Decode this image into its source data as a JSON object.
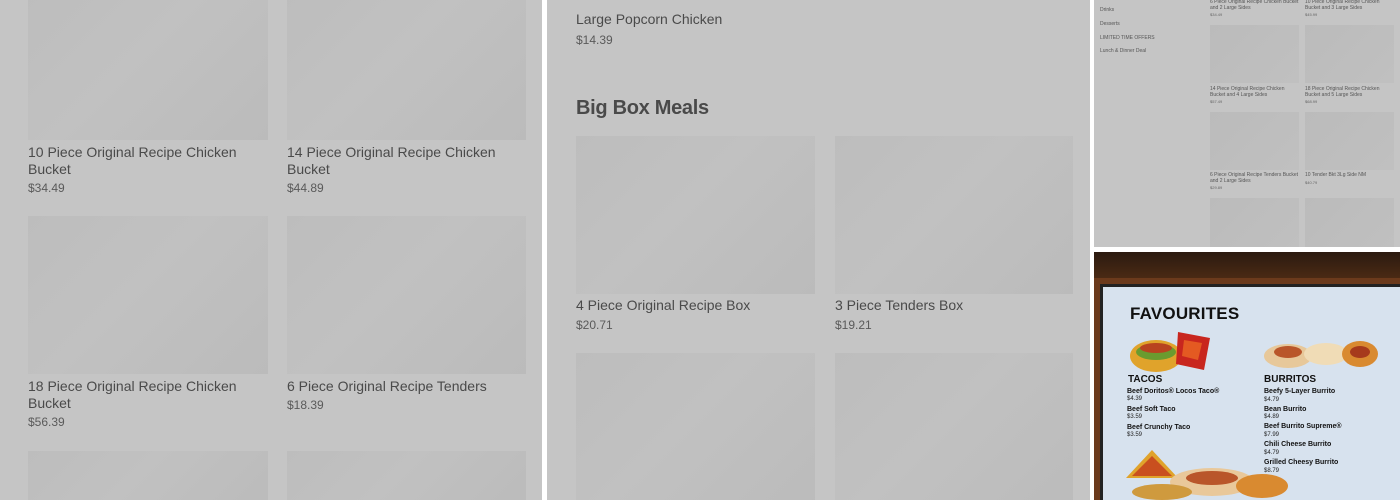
{
  "left_panel": {
    "items": [
      {
        "name": "10 Piece Original Recipe Chicken Bucket",
        "price": "$34.49"
      },
      {
        "name": "14 Piece Original Recipe Chicken Bucket",
        "price": "$44.89"
      },
      {
        "name": "18 Piece Original Recipe Chicken Bucket",
        "price": "$56.39"
      },
      {
        "name": "6 Piece Original Recipe Tenders",
        "price": "$18.39"
      }
    ]
  },
  "middle_panel": {
    "top_item": {
      "name": "Large Popcorn Chicken",
      "price": "$14.39"
    },
    "section_title": "Big Box Meals",
    "items": [
      {
        "name": "4 Piece Original Recipe Box",
        "price": "$20.71"
      },
      {
        "name": "3 Piece Tenders Box",
        "price": "$19.21"
      }
    ]
  },
  "small_panel": {
    "nav": [
      "Drinks",
      "Desserts",
      "LIMITED TIME OFFERS",
      "Lunch & Dinner Deal"
    ],
    "items": [
      {
        "name": "6 Piece Original Recipe Chicken Bucket and 2 Large Sides",
        "price": "$34.49"
      },
      {
        "name": "10 Piece Original Recipe Chicken Bucket and 3 Large Sides",
        "price": "$45.99"
      },
      {
        "name": "14 Piece Original Recipe Chicken Bucket and 4 Large Sides",
        "price": "$57.49"
      },
      {
        "name": "18 Piece Original Recipe Chicken Bucket and 5 Large Sides",
        "price": "$68.99"
      },
      {
        "name": "6 Piece Original Recipe Tenders Bucket and 2 Large Sides",
        "price": "$29.89"
      },
      {
        "name": "10 Tender Bkt 3Lg Side NM",
        "price": "$40.79"
      }
    ]
  },
  "menu_board": {
    "title": "FAVOURITES",
    "tacos": {
      "heading": "TACOS",
      "items": [
        {
          "name": "Beef Doritos® Locos Taco®",
          "price": "$4.39"
        },
        {
          "name": "Beef Soft Taco",
          "price": "$3.59"
        },
        {
          "name": "Beef Crunchy Taco",
          "price": "$3.59"
        }
      ]
    },
    "burritos": {
      "heading": "BURRITOS",
      "items": [
        {
          "name": "Beefy 5-Layer Burrito",
          "price": "$4.79"
        },
        {
          "name": "Bean Burrito",
          "price": "$4.89"
        },
        {
          "name": "Beef Burrito Supreme®",
          "price": "$7.99"
        },
        {
          "name": "Chili Cheese Burrito",
          "price": "$4.79"
        },
        {
          "name": "Grilled Cheesy Burrito",
          "price": "$8.79"
        }
      ]
    }
  }
}
